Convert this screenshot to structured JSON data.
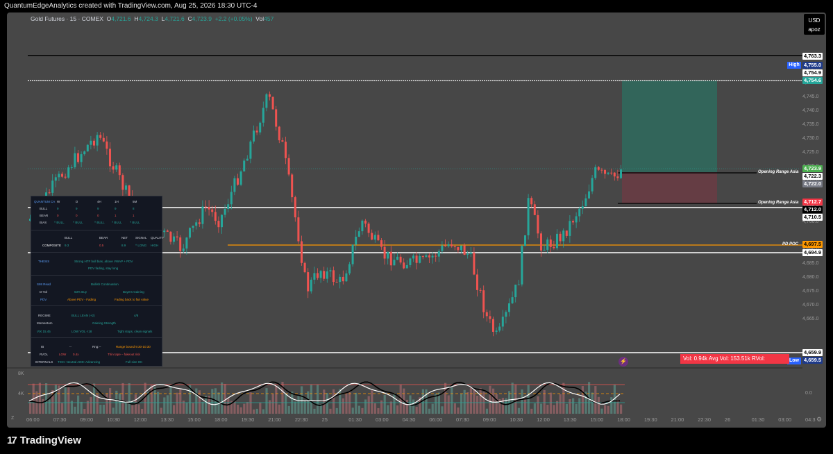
{
  "header": {
    "title": "QuantumEdgeAnalytics created with TradingView.com, Aug 25, 2026 18:30 UTC-4"
  },
  "symbol": {
    "name": "Gold Futures · 15 · COMEX",
    "o_label": "O",
    "o": "4,721.6",
    "h_label": "H",
    "h": "4,724.3",
    "l_label": "L",
    "l": "4,721.6",
    "c_label": "C",
    "c": "4,723.9",
    "change": "+2.2 (+0.05%)",
    "vol_label": "Vol",
    "vol": "457"
  },
  "currency": {
    "code": "USD",
    "user": "apoz"
  },
  "price_scale": {
    "ticks": [
      "4,765.0",
      "4,760.0",
      "4,750.0",
      "4,745.0",
      "4,740.0",
      "4,735.0",
      "4,730.0",
      "4,725.0",
      "4,720.0",
      "4,715.0",
      "4,705.0",
      "4,700.0",
      "4,690.0",
      "4,685.0",
      "4,680.0",
      "4,675.0",
      "4,670.0",
      "4,665.0"
    ],
    "badges": {
      "b4763": "4,763.3",
      "b4755": "4,755.0",
      "b4754_9": "4,754.9",
      "b4754_6": "4,754.6",
      "b4723_9": "4,723.9",
      "b4722_3": "4,722.3",
      "b4722_0": "4,722.0",
      "b4712_7": "4,712.7",
      "b4712_0": "4,712.0",
      "b4710_5": "4,710.5",
      "b4697_5": "4,697.5",
      "b4694_9": "4,694.9",
      "b4659_9": "4,659.9",
      "b4659_5": "4,659.5"
    },
    "high_tag": "High",
    "low_tag": "Low"
  },
  "levels": {
    "opening_range_asia_1": "Opening Range Asia",
    "opening_range_asia_2": "Opening Range Asia",
    "pd_poc": "PD POC"
  },
  "volume_box": "Vol: 0.94k   Avg Vol: 153.51k   RVol:",
  "indicator": {
    "y_8k": "8K",
    "y_4k": "4K",
    "zero": "0.0"
  },
  "time_axis": [
    "06:00",
    "07:30",
    "09:00",
    "10:30",
    "12:00",
    "13:30",
    "15:00",
    "18:00",
    "19:30",
    "21:00",
    "22:30",
    "25",
    "01:30",
    "03:00",
    "04:30",
    "06:00",
    "07:30",
    "09:00",
    "10:30",
    "12:00",
    "13:30",
    "15:00",
    "18:00",
    "19:30",
    "21:00",
    "22:30",
    "26",
    "01:30",
    "03:00",
    "04:3"
  ],
  "panel": {
    "title": "QUANTUM CA",
    "tf": [
      "W",
      "D",
      "4H",
      "1H",
      "5M"
    ],
    "bull_label": "BULL",
    "bull": [
      "9",
      "9",
      "9",
      "9",
      "8"
    ],
    "bear_label": "BEAR",
    "bear": [
      "0",
      "0",
      "0",
      "1",
      "1"
    ],
    "bias_label": "BIAS",
    "bias": [
      "^ BULL",
      "^ BULL",
      "^ BULL",
      "^ BULL",
      "^ BULL"
    ],
    "comp_headers": [
      "BULL",
      "BEAR",
      "NET",
      "SIGNAL",
      "QUALITY"
    ],
    "composite_label": "COMPOSITE",
    "composite": [
      "9.3",
      "0.5",
      "8.9",
      "^ LONG",
      "HIGH"
    ],
    "thesis_label": "THESIS",
    "thesis_1": "Strong HTF bull bias, above VWAP + PDV",
    "thesis_2": "PDV fading, stay long",
    "smi_label": "SMI Read",
    "smi": "Bullish Continuation",
    "dvol_label": "D-Vol",
    "dvol": "63% Buy",
    "dvol_2": "Buyers Gaining",
    "pdv_label": "PDV",
    "pdv": "Above PDV - Fading",
    "pdv_2": "Fading back to fair value",
    "regime_label": "REGIME",
    "regime": "BULL LEAN (+2)",
    "regime_2": "4/8",
    "momentum_label": "Momentum",
    "momentum": "Gaining Strength",
    "vix_label": "VIX 15.45",
    "vix": "LOW VOL <18",
    "vix_2": "Tight stops, clean signals",
    "ib_label": "IB",
    "ib": "--",
    "ib_2": "Rng:--",
    "ib_3": "Range bound 9:30-10:30",
    "rvol_label": "RVOL",
    "rvol": "LOW",
    "rvol_2": "0.4x",
    "rvol_3": "Thin tape – fakeout risk",
    "internals_label": "INTERNALS",
    "internals": "TICK: Neutral  ADD: Advancing",
    "internals_2": "Full size OK"
  },
  "colors": {
    "up": "#26a69a",
    "down": "#ef5350",
    "bg": "#474747",
    "poc": "#ff9800",
    "tp": "#2f6b5e",
    "sl": "#6b3c44"
  },
  "footer": {
    "brand": "TradingView"
  }
}
